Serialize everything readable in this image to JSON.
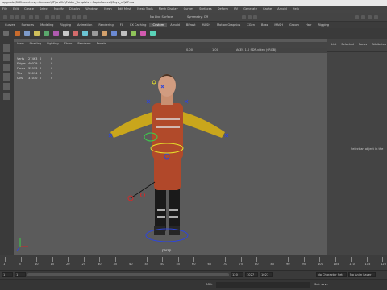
{
  "window": {
    "title": "upgrade\\SKCharacters\\...Cartoon\\ST\\profile\\Folder_Template - CopiaSource\\Maya_m\\WF.ma"
  },
  "menu": [
    "File",
    "Edit",
    "Create",
    "Select",
    "Modify",
    "Display",
    "Windows",
    "Mesh",
    "Edit Mesh",
    "Mesh Tools",
    "Mesh Display",
    "Curves",
    "Surfaces",
    "Deform",
    "UV",
    "Generate",
    "Cache",
    "Arnold",
    "Help"
  ],
  "toolbar": {
    "no_live_surface": "No Live Surface",
    "symmetry": "Symmetry: Off"
  },
  "shelf": {
    "tabs": [
      "Curves",
      "Surfaces",
      "Modeling",
      "Rigging",
      "Animation",
      "Rendering",
      "FX",
      "FX Caching",
      "Custom",
      "Arnold",
      "Bifrost",
      "MASH",
      "Motion Graphics",
      "XGen",
      "Boss",
      "MASH",
      "Groom",
      "Hair",
      "Rigging"
    ],
    "active_index": 8
  },
  "viewport": {
    "menu": [
      "View",
      "Shading",
      "Lighting",
      "Show",
      "Renderer",
      "Panels"
    ],
    "toolbar_values": {
      "value_a": "0.00",
      "value_b": "1.00",
      "colorspace": "ACES 1.0 SDR-video (sRGB)"
    },
    "hud": [
      {
        "label": "Verts",
        "a": "27463",
        "b": "0",
        "c": "0"
      },
      {
        "label": "Edges",
        "a": "40029",
        "b": "0",
        "c": "0"
      },
      {
        "label": "Faces",
        "a": "35993",
        "b": "0",
        "c": "0"
      },
      {
        "label": "Tris",
        "a": "53094",
        "b": "0",
        "c": "0"
      },
      {
        "label": "UVs",
        "a": "31030",
        "b": "0",
        "c": "0"
      }
    ],
    "camera": "persp"
  },
  "right_panel": {
    "tabs": [
      "List",
      "Selected",
      "Focus",
      "Attributes"
    ],
    "message": "Select an object in the"
  },
  "timeline": {
    "ticks": [
      "1",
      "5",
      "10",
      "15",
      "20",
      "25",
      "30",
      "35",
      "40",
      "45",
      "50",
      "55",
      "60",
      "65",
      "70",
      "75",
      "80",
      "85",
      "90",
      "95",
      "100",
      "105",
      "110",
      "115",
      "120"
    ]
  },
  "range": {
    "start": "1",
    "inner_start": "1",
    "inner_end": "120",
    "end": "1027",
    "end2": "1027",
    "character_set": "No Character Set",
    "anim_layer": "No Anim Layer",
    "fps": "24 fps"
  },
  "command": {
    "mode": "MEL",
    "status": "Set: save"
  },
  "colors": {
    "selection": "#3fa9e0",
    "joint_blue": "#2f46d8",
    "ik_red": "#d22a2a",
    "ctrl_yellow": "#e7e22a",
    "ctrl_green": "#3bd14a"
  }
}
